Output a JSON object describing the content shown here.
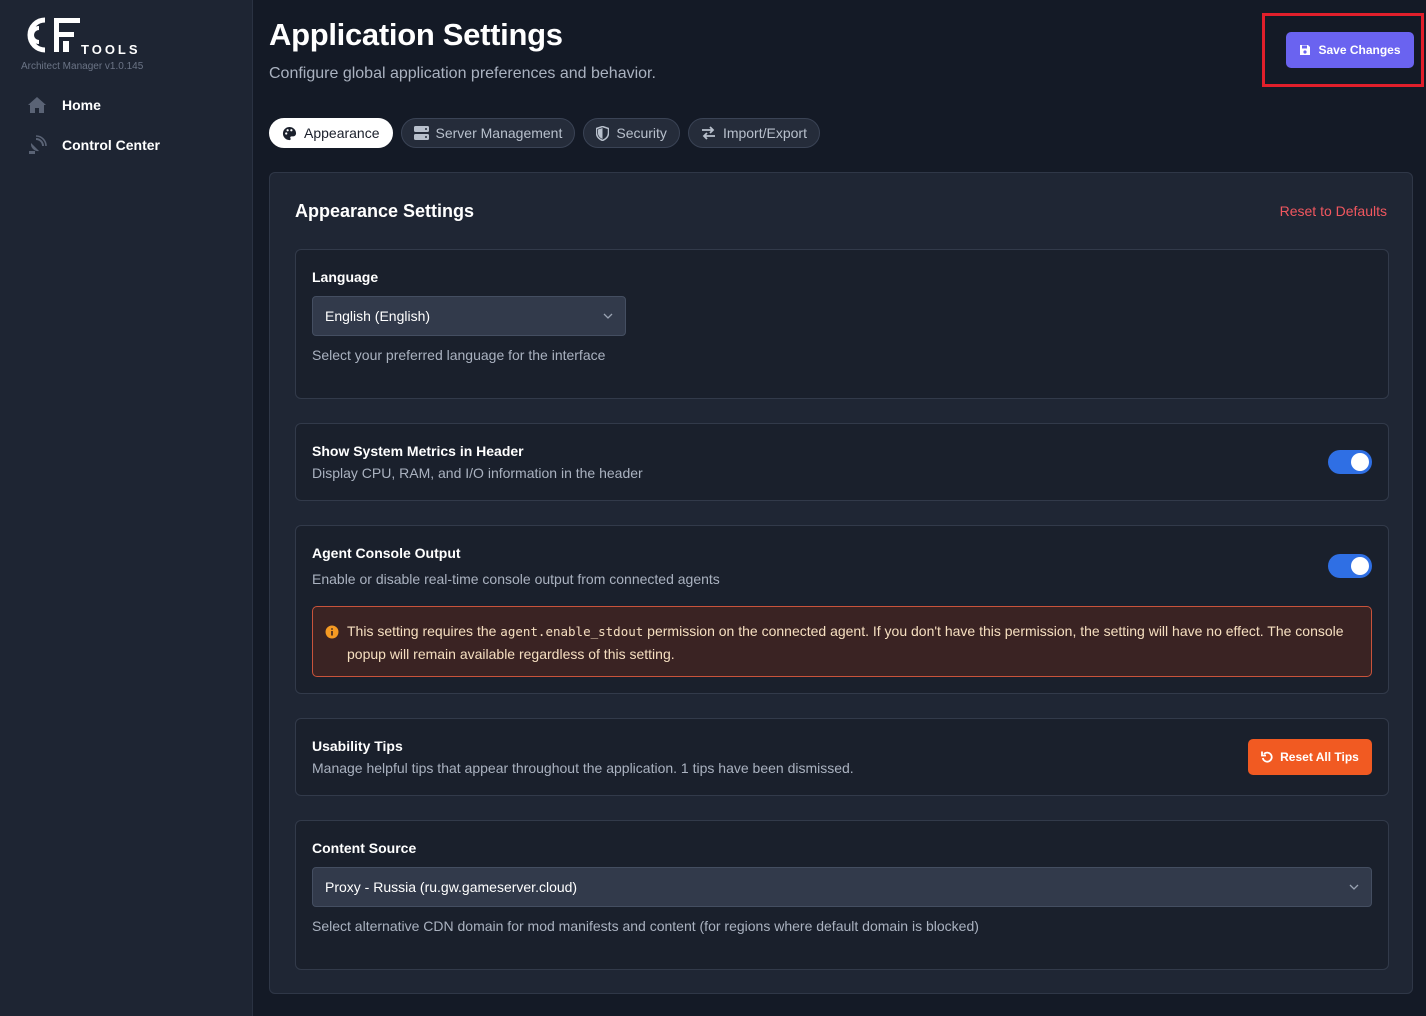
{
  "app": {
    "logo_text": "TOOLS",
    "logo_mark_text": "CF",
    "version": "Architect Manager v1.0.145"
  },
  "sidebar": {
    "items": [
      {
        "label": "Home",
        "icon": "home-icon"
      },
      {
        "label": "Control Center",
        "icon": "satellite-dish-icon"
      }
    ]
  },
  "header": {
    "title": "Application Settings",
    "subtitle": "Configure global application preferences and behavior.",
    "save_label": "Save Changes"
  },
  "tabs": [
    {
      "label": "Appearance",
      "icon": "palette-icon",
      "active": true
    },
    {
      "label": "Server Management",
      "icon": "server-icon",
      "active": false
    },
    {
      "label": "Security",
      "icon": "shield-icon",
      "active": false
    },
    {
      "label": "Import/Export",
      "icon": "arrows-exchange-icon",
      "active": false
    }
  ],
  "panel": {
    "title": "Appearance Settings",
    "reset_label": "Reset to Defaults"
  },
  "language": {
    "title": "Language",
    "value": "English (English)",
    "description": "Select your preferred language for the interface"
  },
  "metrics": {
    "title": "Show System Metrics in Header",
    "description": "Display CPU, RAM, and I/O information in the header",
    "enabled": true
  },
  "console": {
    "title": "Agent Console Output",
    "description": "Enable or disable real-time console output from connected agents",
    "enabled": true,
    "warning_before": "This setting requires the ",
    "warning_code": "agent.enable_stdout",
    "warning_after": " permission on the connected agent. If you don't have this permission, the setting will have no effect. The console popup will remain available regardless of this setting."
  },
  "tips": {
    "title": "Usability Tips",
    "description": "Manage helpful tips that appear throughout the application. 1 tips have been dismissed.",
    "button_label": "Reset All Tips"
  },
  "content_source": {
    "title": "Content Source",
    "value": "Proxy - Russia (ru.gw.gameserver.cloud)",
    "description": "Select alternative CDN domain for mod manifests and content (for regions where default domain is blocked)"
  },
  "colors": {
    "accent": "#6a63f0",
    "toggle_on": "#2f6fe4",
    "danger": "#f0575f",
    "orange": "#f15a22",
    "highlight": "#e01f2b"
  }
}
